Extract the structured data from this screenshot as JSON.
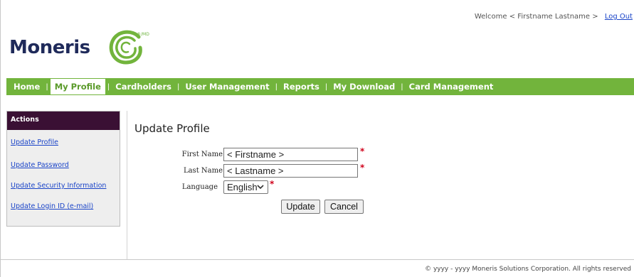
{
  "header": {
    "welcome_text": "Welcome < Firstname Lastname >",
    "logout_label": "Log Out"
  },
  "logo": {
    "wordmark": "Moneris",
    "registered": "®/MD",
    "brand_color": "#72b43c",
    "text_color": "#1f2a5a"
  },
  "nav": {
    "items": [
      {
        "label": "Home"
      },
      {
        "label": "My Profile",
        "active": true
      },
      {
        "label": "Cardholders"
      },
      {
        "label": "User Management"
      },
      {
        "label": "Reports"
      },
      {
        "label": "My Download"
      },
      {
        "label": "Card Management"
      }
    ],
    "separator": "|"
  },
  "sidebar": {
    "header": "Actions",
    "header_color": "#3a1034",
    "links": [
      {
        "label": "Update Profile"
      },
      {
        "label": "Update Password"
      },
      {
        "label": "Update Security Information"
      },
      {
        "label": "Update Login ID (e-mail)"
      }
    ]
  },
  "main": {
    "title": "Update Profile",
    "fields": {
      "first_name": {
        "label": "First Name",
        "value": "< Firstname >"
      },
      "last_name": {
        "label": "Last Name",
        "value": "< Lastname >"
      },
      "language": {
        "label": "Language",
        "value": "English"
      }
    },
    "required_marker": "*",
    "buttons": {
      "update": "Update",
      "cancel": "Cancel"
    }
  },
  "footer": {
    "text": "© yyyy - yyyy  Moneris Solutions Corporation. All rights reserved"
  }
}
